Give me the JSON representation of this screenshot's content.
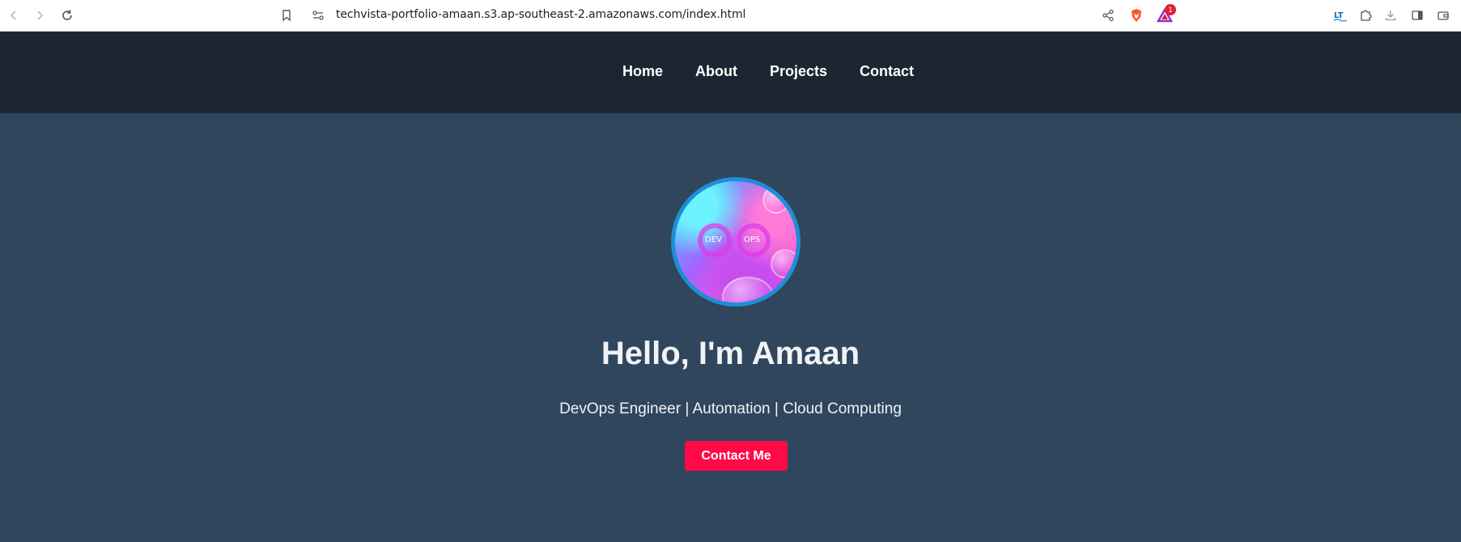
{
  "browser": {
    "url": "techvista-portfolio-amaan.s3.ap-southeast-2.amazonaws.com/index.html",
    "notification_count": "1"
  },
  "nav": {
    "items": [
      {
        "label": "Home"
      },
      {
        "label": "About"
      },
      {
        "label": "Projects"
      },
      {
        "label": "Contact"
      }
    ]
  },
  "hero": {
    "avatar_left_text": "DEV",
    "avatar_right_text": "OPS",
    "headline": "Hello, I'm Amaan",
    "tagline": "DevOps Engineer | Automation | Cloud Computing",
    "cta_label": "Contact Me"
  },
  "colors": {
    "nav_bg": "#1b2632",
    "hero_bg": "#2f465d",
    "cta_bg": "#ff0a47",
    "avatar_border": "#1d8fd4"
  },
  "icons": [
    "back-icon",
    "forward-icon",
    "reload-icon",
    "bookmark-icon",
    "site-info-icon",
    "share-icon",
    "brave-shield-icon",
    "brave-rewards-icon",
    "translate-icon",
    "extensions-icon",
    "download-icon",
    "sidebar-icon",
    "wallet-icon"
  ]
}
